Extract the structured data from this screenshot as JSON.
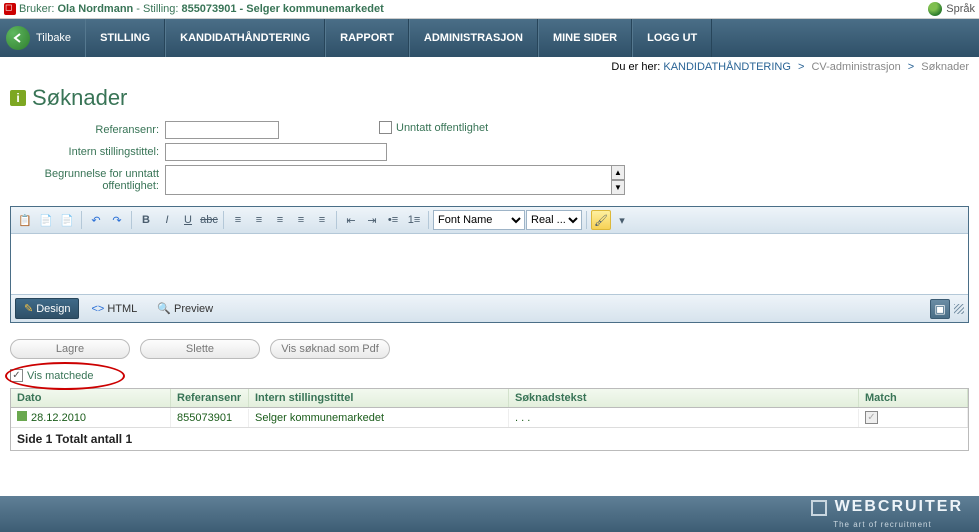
{
  "topbar": {
    "user_prefix": "Bruker:",
    "user_name": "Ola Nordmann",
    "stilling_prefix": "- Stilling:",
    "stilling_id": "855073901",
    "stilling_title": "- Selger kommunemarkedet",
    "lang_label": "Språk"
  },
  "nav": {
    "back": "Tilbake",
    "items": [
      "STILLING",
      "KANDIDATHÅNDTERING",
      "RAPPORT",
      "ADMINISTRASJON",
      "MINE SIDER",
      "LOGG UT"
    ]
  },
  "breadcrumb": {
    "prefix": "Du er her:",
    "items": [
      "KANDIDATHÅNDTERING",
      "CV-administrasjon",
      "Søknader"
    ]
  },
  "page": {
    "title": "Søknader",
    "labels": {
      "ref": "Referansenr:",
      "intern": "Intern stillingstittel:",
      "begrunn": "Begrunnelse for unntatt offentlighet:",
      "unntatt": "Unntatt offentlighet"
    },
    "values": {
      "ref": "",
      "intern": "",
      "begrunn": ""
    },
    "unntatt_checked": false
  },
  "editor": {
    "font_name_placeholder": "Font Name",
    "real_size_placeholder": "Real ...",
    "tabs": {
      "design": "Design",
      "html": "HTML",
      "preview": "Preview"
    }
  },
  "buttons": {
    "lagre": "Lagre",
    "slette": "Slette",
    "vis_pdf": "Vis søknad som Pdf"
  },
  "vis_match": {
    "label": "Vis matchede",
    "checked": true
  },
  "grid": {
    "headers": {
      "dato": "Dato",
      "ref": "Referansenr",
      "intern": "Intern stillingstittel",
      "sok": "Søknadstekst",
      "match": "Match"
    },
    "rows": [
      {
        "dato": "28.12.2010",
        "ref": "855073901",
        "intern": "Selger kommunemarkedet",
        "sok": ". . .",
        "match": true
      }
    ],
    "footer": "Side   1    Totalt antall 1"
  },
  "brand": {
    "name": "WEBCRUITER",
    "tag": "The art of recruitment"
  }
}
